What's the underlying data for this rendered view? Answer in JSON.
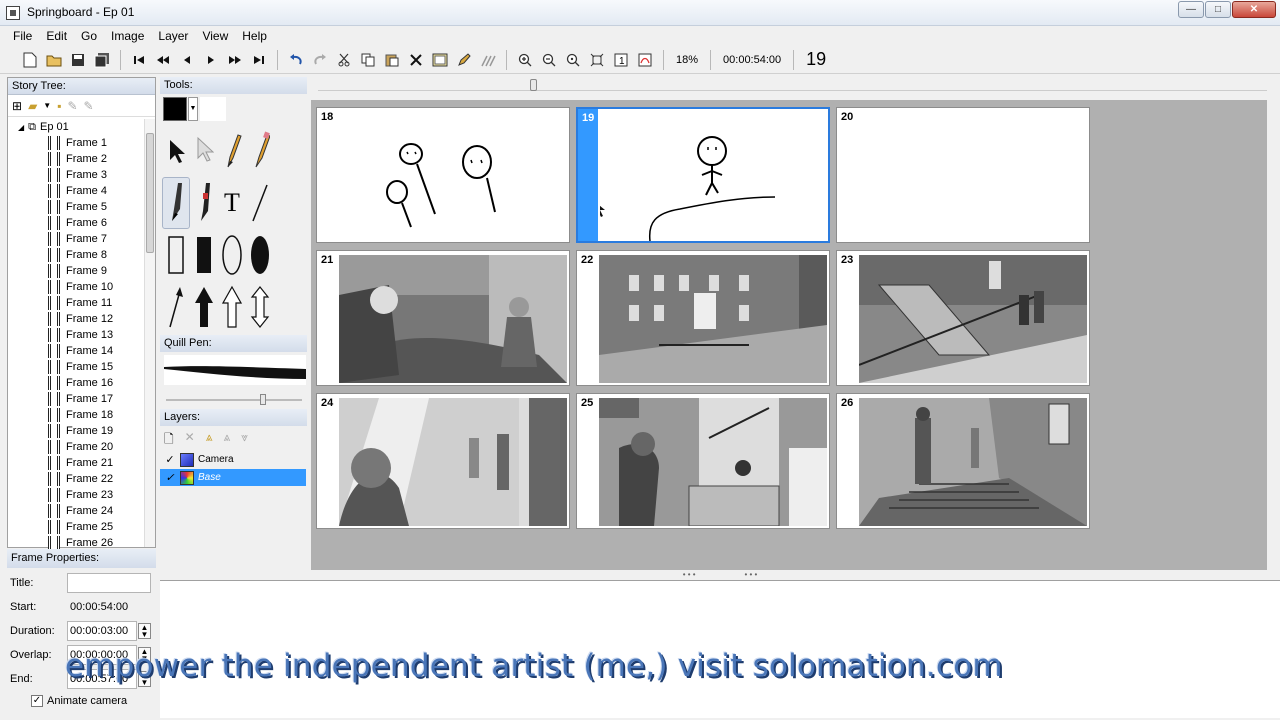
{
  "window": {
    "title": "Springboard - Ep 01",
    "min_label": "—",
    "max_label": "□",
    "close_label": "✕"
  },
  "menu": [
    "File",
    "Edit",
    "Go",
    "Image",
    "Layer",
    "View",
    "Help"
  ],
  "toolbar": {
    "zoom": "18%",
    "timecode": "00:00:54:00",
    "current_frame": "19"
  },
  "story_tree": {
    "header": "Story Tree:",
    "root": "Ep 01",
    "frames": [
      "Frame 1",
      "Frame 2",
      "Frame 3",
      "Frame 4",
      "Frame 5",
      "Frame 6",
      "Frame 7",
      "Frame 8",
      "Frame 9",
      "Frame 10",
      "Frame 11",
      "Frame 12",
      "Frame 13",
      "Frame 14",
      "Frame 15",
      "Frame 16",
      "Frame 17",
      "Frame 18",
      "Frame 19",
      "Frame 20",
      "Frame 21",
      "Frame 22",
      "Frame 23",
      "Frame 24",
      "Frame 25",
      "Frame 26"
    ]
  },
  "tools": {
    "header": "Tools:",
    "quill_header": "Quill Pen:",
    "brush_color": "#000000",
    "text_tool_glyph": "T"
  },
  "layers": {
    "header": "Layers:",
    "items": [
      {
        "name": "Camera",
        "checked": "✓",
        "color": "#3355ee"
      },
      {
        "name": "Base",
        "checked": "✓",
        "color": "#33aa44"
      }
    ]
  },
  "frame_properties": {
    "header": "Frame Properties:",
    "title_label": "Title:",
    "title_value": "",
    "start_label": "Start:",
    "start_value": "00:00:54:00",
    "duration_label": "Duration:",
    "duration_value": "00:00:03:00",
    "overlap_label": "Overlap:",
    "overlap_value": "00:00:00:00",
    "end_label": "End:",
    "end_value": "00:00:57:00",
    "animate_label": "Animate camera",
    "animate_checked": "✓"
  },
  "storyboard": {
    "frames": [
      {
        "number": "18",
        "kind": "sketch"
      },
      {
        "number": "19",
        "kind": "sketch-selected"
      },
      {
        "number": "20",
        "kind": "blank"
      },
      {
        "number": "21",
        "kind": "bedroom"
      },
      {
        "number": "22",
        "kind": "street"
      },
      {
        "number": "23",
        "kind": "stairs"
      },
      {
        "number": "24",
        "kind": "hallway"
      },
      {
        "number": "25",
        "kind": "lobby"
      },
      {
        "number": "26",
        "kind": "staircase"
      }
    ]
  },
  "watermark": "empower the independent artist (me,) visit solomation.com"
}
